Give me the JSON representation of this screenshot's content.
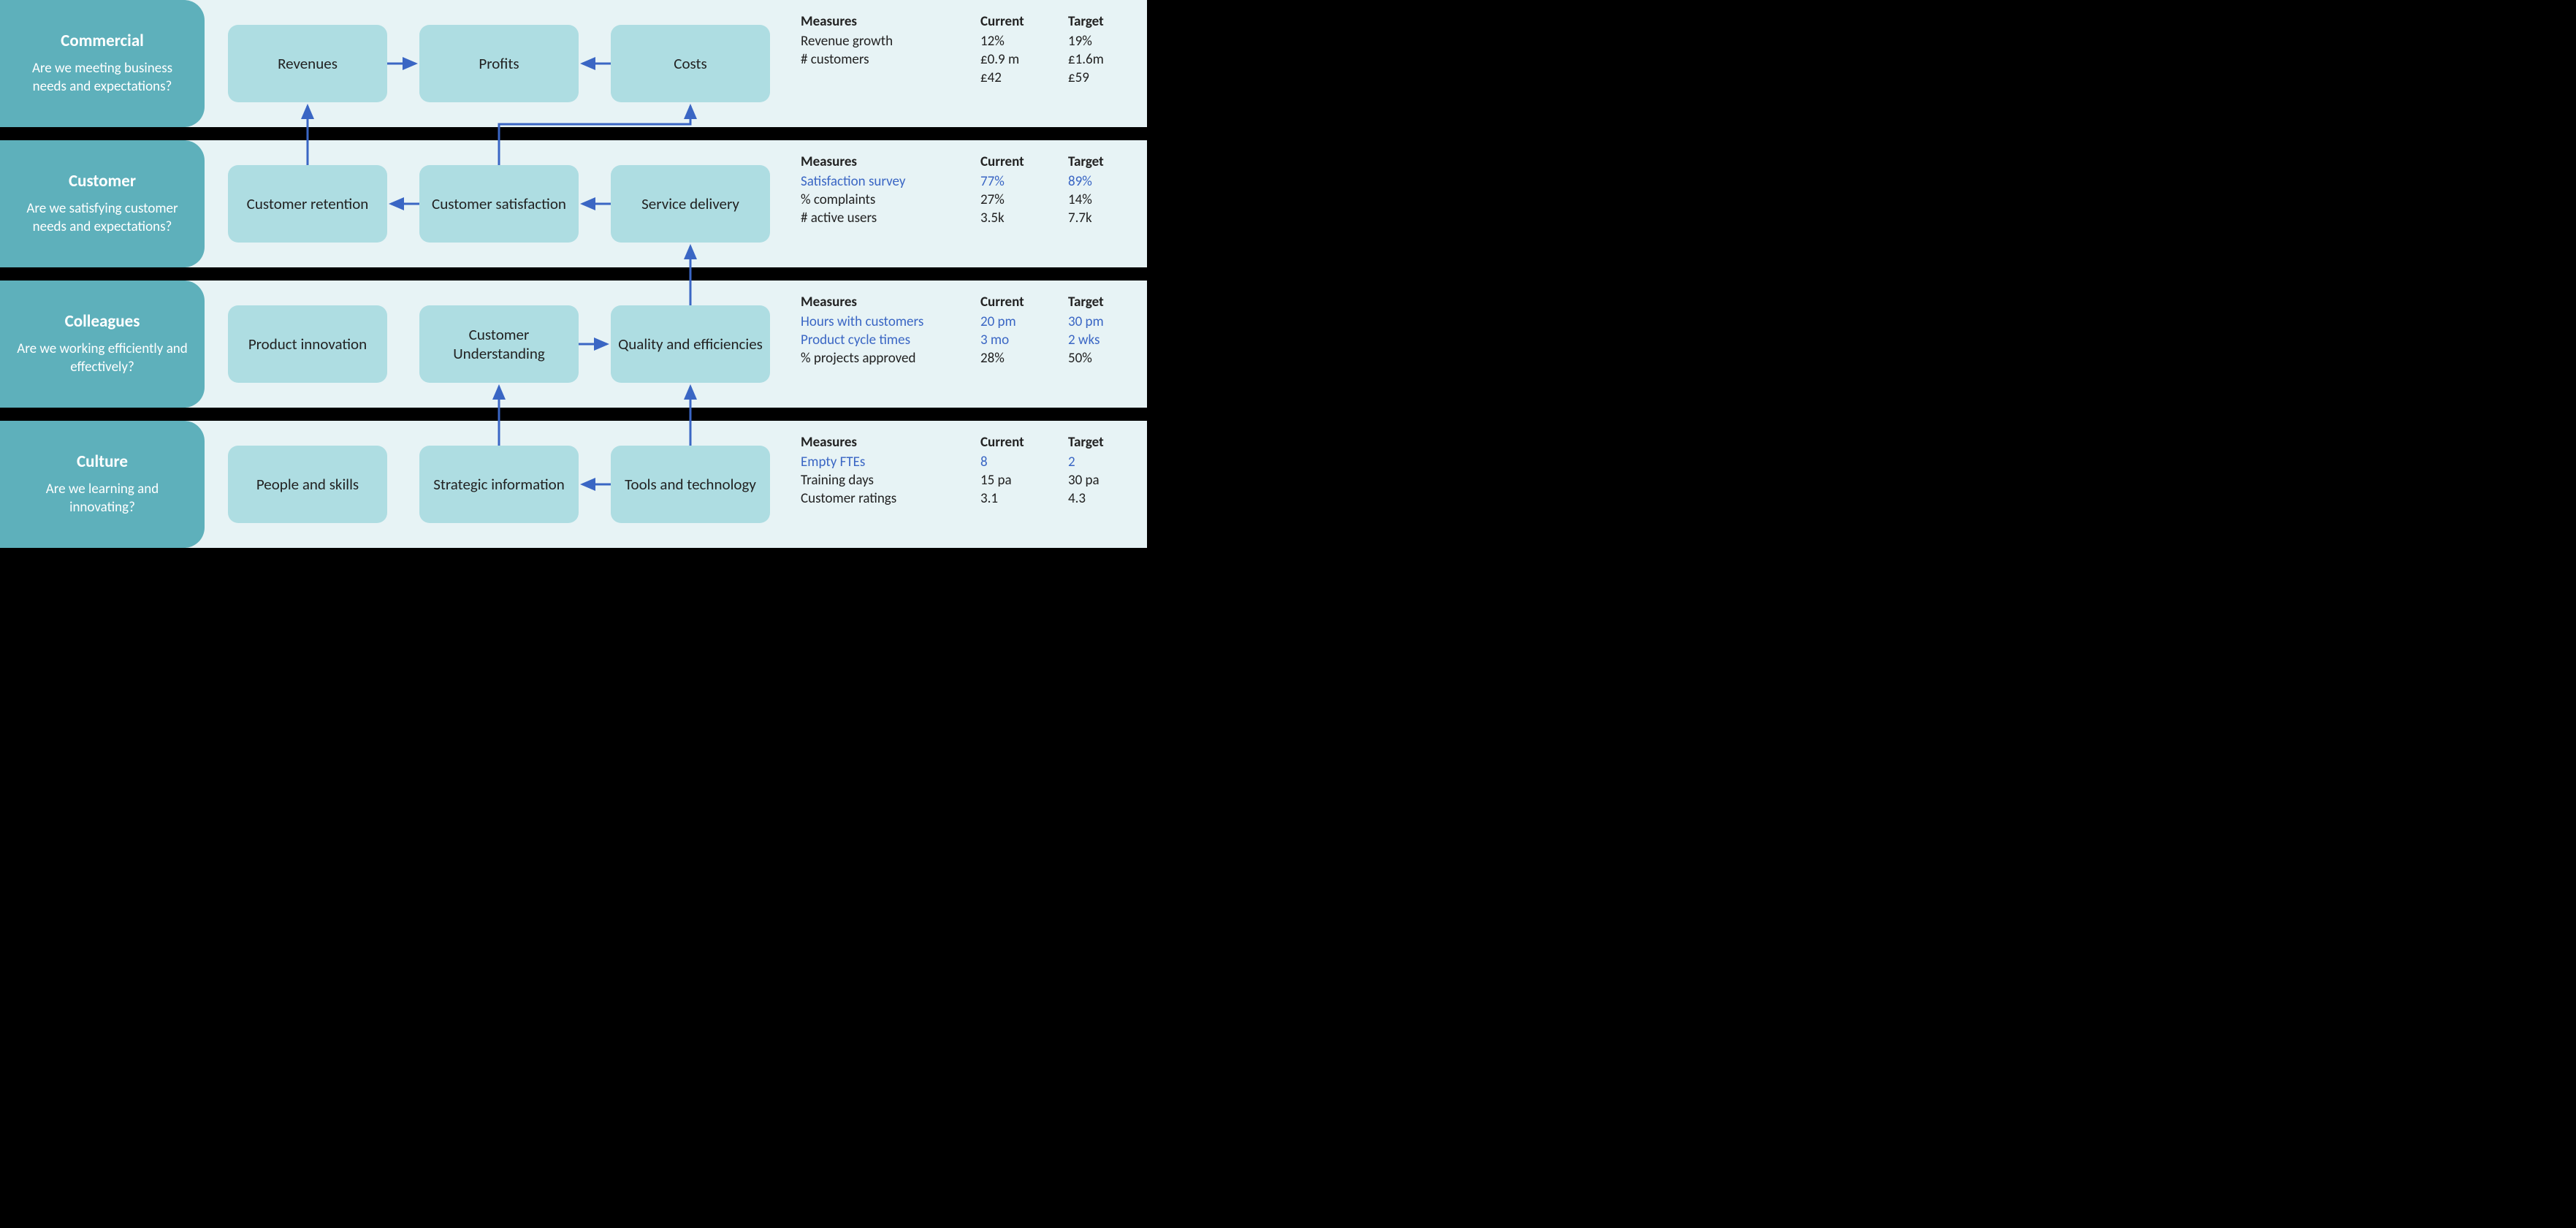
{
  "columns": {
    "measures": "Measures",
    "current": "Current",
    "target": "Target"
  },
  "rows": [
    {
      "key": "commercial",
      "title": "Commercial",
      "subtitle": "Are we meeting business needs and expectations?",
      "nodes": [
        "Revenues",
        "Profits",
        "Costs"
      ],
      "measures": [
        {
          "label": "Revenue growth",
          "current": "12%",
          "target": "19%",
          "link": false
        },
        {
          "label": "# customers",
          "current": "£0.9 m",
          "target": "£1.6m",
          "link": false
        },
        {
          "label": "",
          "current": "£42",
          "target": "£59",
          "link": false
        }
      ]
    },
    {
      "key": "customer",
      "title": "Customer",
      "subtitle": "Are we satisfying customer needs and expectations?",
      "nodes": [
        "Customer retention",
        "Customer satisfaction",
        "Service delivery"
      ],
      "measures": [
        {
          "label": "Satisfaction survey",
          "current": "77%",
          "target": "89%",
          "link": true
        },
        {
          "label": "% complaints",
          "current": "27%",
          "target": "14%",
          "link": false
        },
        {
          "label": "# active users",
          "current": "3.5k",
          "target": "7.7k",
          "link": false
        }
      ]
    },
    {
      "key": "colleagues",
      "title": "Colleagues",
      "subtitle": "Are we working efficiently and effectively?",
      "nodes": [
        "Product innovation",
        "Customer Understanding",
        "Quality and efficiencies"
      ],
      "measures": [
        {
          "label": "Hours with customers",
          "current": "20 pm",
          "target": "30 pm",
          "link": true
        },
        {
          "label": "Product cycle times",
          "current": "3 mo",
          "target": "2 wks",
          "link": true
        },
        {
          "label": "% projects approved",
          "current": "28%",
          "target": "50%",
          "link": false
        }
      ]
    },
    {
      "key": "culture",
      "title": "Culture",
      "subtitle": "Are we learning and innovating?",
      "nodes": [
        "People and skills",
        "Strategic information",
        "Tools and technology"
      ],
      "measures": [
        {
          "label": "Empty FTEs",
          "current": "8",
          "target": "2",
          "link": true
        },
        {
          "label": "Training days",
          "current": "15 pa",
          "target": "30 pa",
          "link": false
        },
        {
          "label": "Customer ratings",
          "current": "3.1",
          "target": "4.3",
          "link": false
        }
      ]
    }
  ],
  "arrows": [
    {
      "from": "commercial.0",
      "to": "commercial.1",
      "dir": "right"
    },
    {
      "from": "commercial.2",
      "to": "commercial.1",
      "dir": "left"
    },
    {
      "from": "customer.0",
      "to": "commercial.0",
      "dir": "up"
    },
    {
      "from": "customer.1",
      "to": "customer.0",
      "dir": "left"
    },
    {
      "from": "customer.2",
      "to": "customer.1",
      "dir": "left"
    },
    {
      "from": "customer.1",
      "to": "commercial.2",
      "via": "elbow-up-right"
    },
    {
      "from": "colleagues.1",
      "to": "colleagues.2",
      "dir": "right"
    },
    {
      "from": "colleagues.2",
      "to": "customer.2",
      "dir": "up"
    },
    {
      "from": "culture.1",
      "to": "colleagues.1",
      "dir": "up"
    },
    {
      "from": "culture.2",
      "to": "colleagues.2",
      "dir": "up"
    },
    {
      "from": "culture.2",
      "to": "culture.1",
      "dir": "left"
    }
  ]
}
